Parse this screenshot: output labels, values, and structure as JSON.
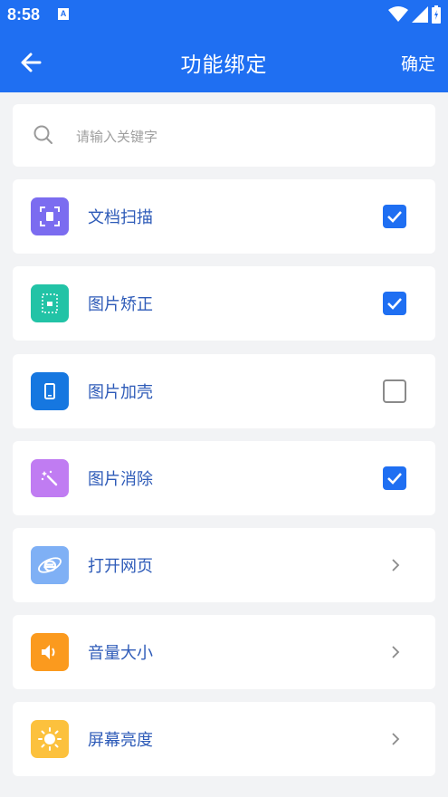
{
  "status_bar": {
    "time": "8:58",
    "notification_letter": "A"
  },
  "header": {
    "title": "功能绑定",
    "confirm_label": "确定"
  },
  "search": {
    "placeholder": "请输入关键字"
  },
  "items": [
    {
      "label": "文档扫描",
      "icon": "document-scan-icon",
      "color": "#7b6cf0",
      "control": "checkbox",
      "checked": true
    },
    {
      "label": "图片矫正",
      "icon": "image-correct-icon",
      "color": "#22c3a6",
      "control": "checkbox",
      "checked": true
    },
    {
      "label": "图片加壳",
      "icon": "phone-frame-icon",
      "color": "#1677e0",
      "control": "checkbox",
      "checked": false
    },
    {
      "label": "图片消除",
      "icon": "magic-wand-icon",
      "color": "#c07cf2",
      "control": "checkbox",
      "checked": true
    },
    {
      "label": "打开网页",
      "icon": "browser-icon",
      "color": "#7fb0f5",
      "control": "chevron"
    },
    {
      "label": "音量大小",
      "icon": "volume-icon",
      "color": "#fb9a1e",
      "control": "chevron"
    },
    {
      "label": "屏幕亮度",
      "icon": "brightness-icon",
      "color": "#fcc13d",
      "control": "chevron"
    }
  ],
  "colors": {
    "primary": "#1f6ff2",
    "label": "#2e5bb8",
    "background": "#f2f3f5"
  }
}
